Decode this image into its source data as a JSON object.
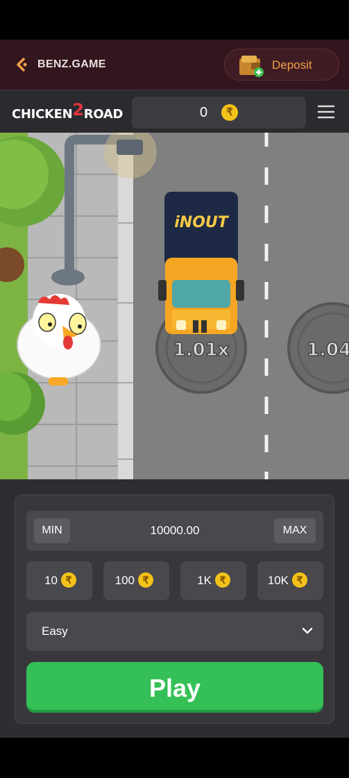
{
  "header": {
    "brand": "BENZ.GAME",
    "deposit_label": "Deposit"
  },
  "game_bar": {
    "logo_part1": "CHICKEN",
    "logo_two": "2",
    "logo_part2": "ROAD",
    "balance": "0",
    "currency_symbol": "₹"
  },
  "scene": {
    "truck_brand": "iNOUT",
    "multipliers": [
      "1.01x",
      "1.04"
    ]
  },
  "controls": {
    "min_label": "MIN",
    "max_label": "MAX",
    "bet_amount": "10000.00",
    "quick_bets": [
      "10",
      "100",
      "1K",
      "10K"
    ],
    "difficulty": "Easy",
    "play_label": "Play"
  },
  "colors": {
    "header_bg": "#33161d",
    "deposit_text": "#f2a14a",
    "play_green": "#35c057",
    "coin_gold": "#f3c21a"
  }
}
